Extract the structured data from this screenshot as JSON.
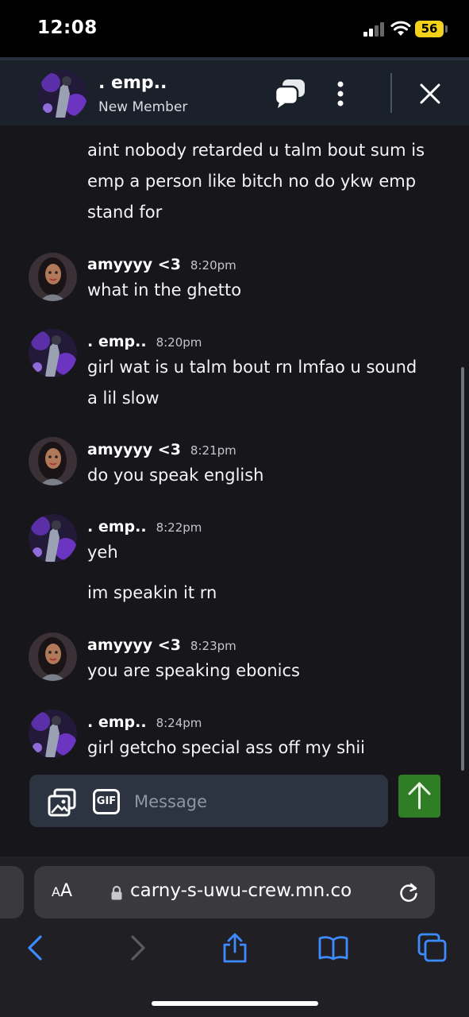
{
  "status_bar": {
    "time": "12:08",
    "battery": "56"
  },
  "header": {
    "name": ". emp..",
    "role": "New Member"
  },
  "messages": [
    {
      "author": "",
      "time": "",
      "lines": [
        "aint nobody retarded u talm bout sum is",
        "emp a person like bitch no do ykw emp",
        "stand for"
      ]
    },
    {
      "author": "amyyyy <3",
      "time": "8:20pm",
      "lines": [
        "what in the ghetto"
      ]
    },
    {
      "author": ". emp..",
      "time": "8:20pm",
      "lines": [
        "girl wat is u talm bout rn lmfao u sound",
        "a lil slow"
      ]
    },
    {
      "author": "amyyyy <3",
      "time": "8:21pm",
      "lines": [
        "do you speak english"
      ]
    },
    {
      "author": ". emp..",
      "time": "8:22pm",
      "lines": [
        "yeh"
      ]
    },
    {
      "author": "",
      "time": "",
      "lines": [
        "im speakin it rn"
      ]
    },
    {
      "author": "amyyyy <3",
      "time": "8:23pm",
      "lines": [
        "you are speaking ebonics"
      ]
    },
    {
      "author": ". emp..",
      "time": "8:24pm",
      "lines": [
        "girl getcho special ass off my shii"
      ]
    }
  ],
  "composer": {
    "gif_label": "GIF",
    "placeholder": "Message"
  },
  "browser": {
    "aa_big": "A",
    "aa_small": "A",
    "url": "carny-s-uwu-crew.mn.co"
  },
  "colors": {
    "send": "#2f7d24",
    "header_bg": "#1b212b",
    "composer_bg": "#2b3440",
    "battery": "#f2d21b"
  },
  "icons": [
    "chats-icon",
    "more-vertical-icon",
    "close-icon",
    "gallery-icon",
    "gif-icon",
    "send-arrow-icon",
    "lock-icon",
    "reload-icon",
    "back-icon",
    "forward-icon",
    "share-icon",
    "bookmarks-icon",
    "tabs-icon"
  ]
}
